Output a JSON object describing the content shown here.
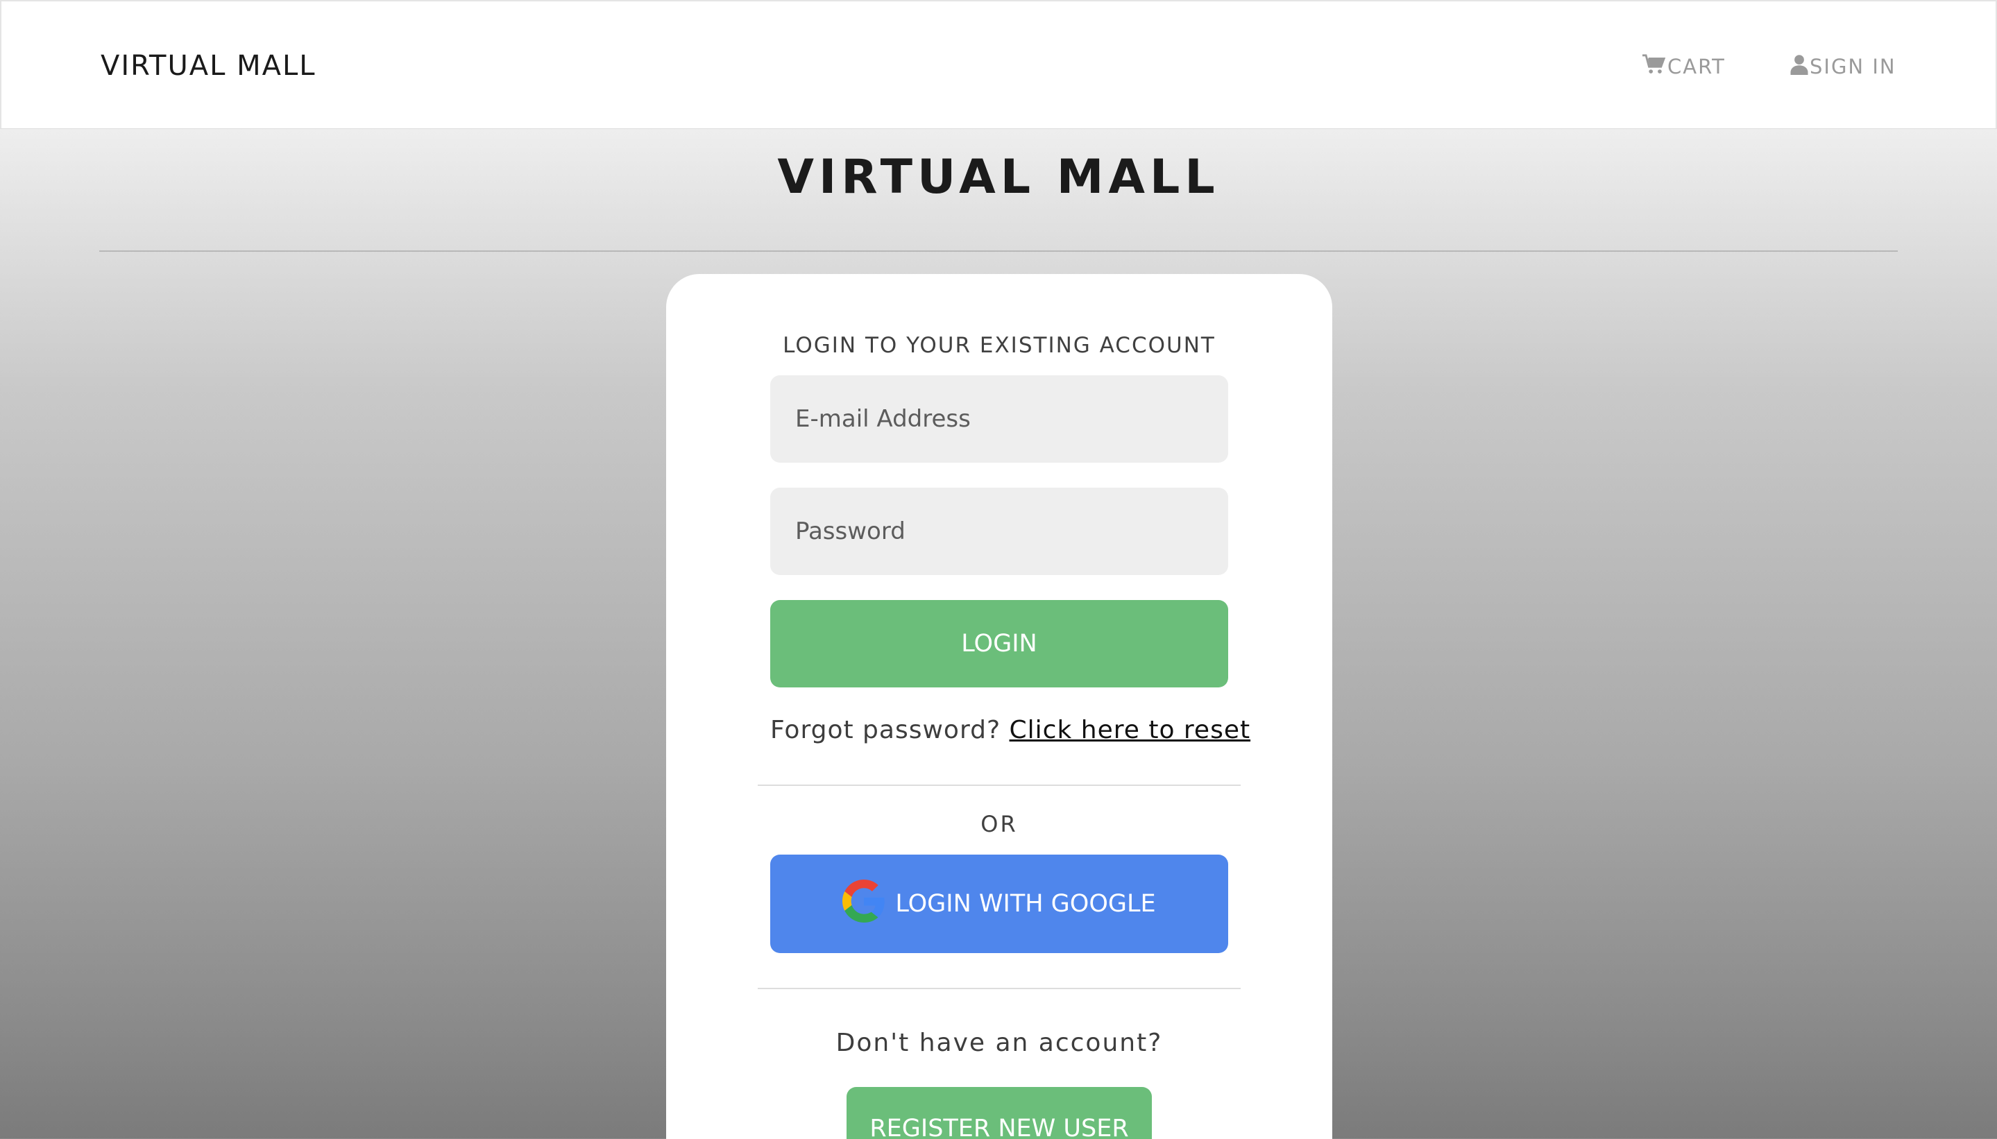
{
  "navbar": {
    "brand": "VIRTUAL MALL",
    "cart_label": "CART",
    "cart_icon": "cart-icon",
    "signin_label": "SIGN IN",
    "signin_icon": "user-icon"
  },
  "hero": {
    "title": "VIRTUAL MALL"
  },
  "login_card": {
    "heading": "LOGIN TO YOUR EXISTING ACCOUNT",
    "email_placeholder": "E-mail Address",
    "email_value": "",
    "password_placeholder": "Password",
    "password_value": "",
    "login_button": "LOGIN",
    "forgot_prefix": "Forgot password?",
    "forgot_link": "Click here to reset",
    "or_text": "OR",
    "google_button": "LOGIN WITH GOOGLE",
    "google_icon": "google-icon",
    "no_account_text": "Don't have an account?",
    "register_button": "REGISTER NEW USER"
  },
  "colors": {
    "green_button": "#6bbe7a",
    "google_button": "#4f86ec",
    "input_background": "#eeeeee",
    "nav_link": "#9a9a9a"
  }
}
